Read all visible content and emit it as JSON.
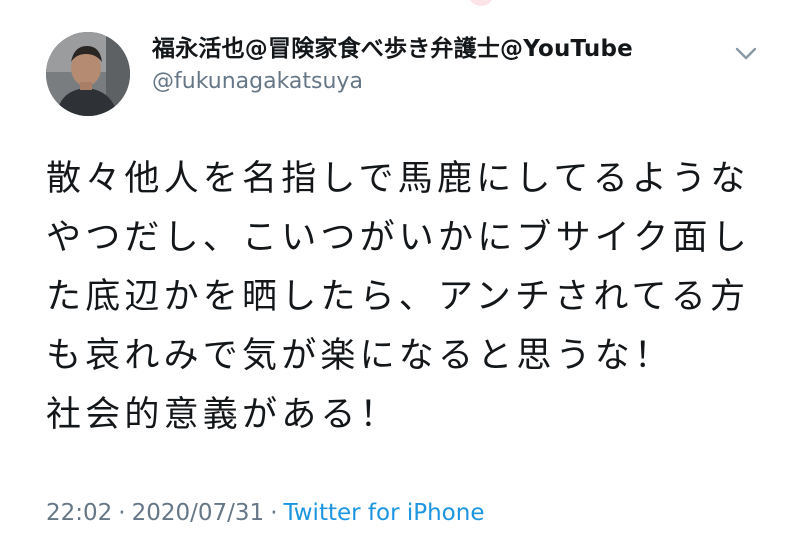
{
  "user": {
    "display_name": "福永活也@冒険家食べ歩き弁護士@YouTube",
    "handle": "@fukunagakatsuya"
  },
  "tweet": {
    "lines": [
      "散々他人を名指しで馬鹿にしてるような",
      "やつだし、こいつがいかにブサイク面し",
      "た底辺かを晒したら、アンチされてる方",
      "も哀れみで気が楽になると思うな！",
      "社会的意義がある！"
    ],
    "time": "22:02",
    "date": "2020/07/31",
    "separator": "·",
    "source": "Twitter for iPhone"
  },
  "icons": {
    "menu": "chevron-down-icon",
    "avatar": "profile-photo"
  },
  "colors": {
    "text": "#14171a",
    "secondary": "#657786",
    "link": "#1b95e0"
  }
}
